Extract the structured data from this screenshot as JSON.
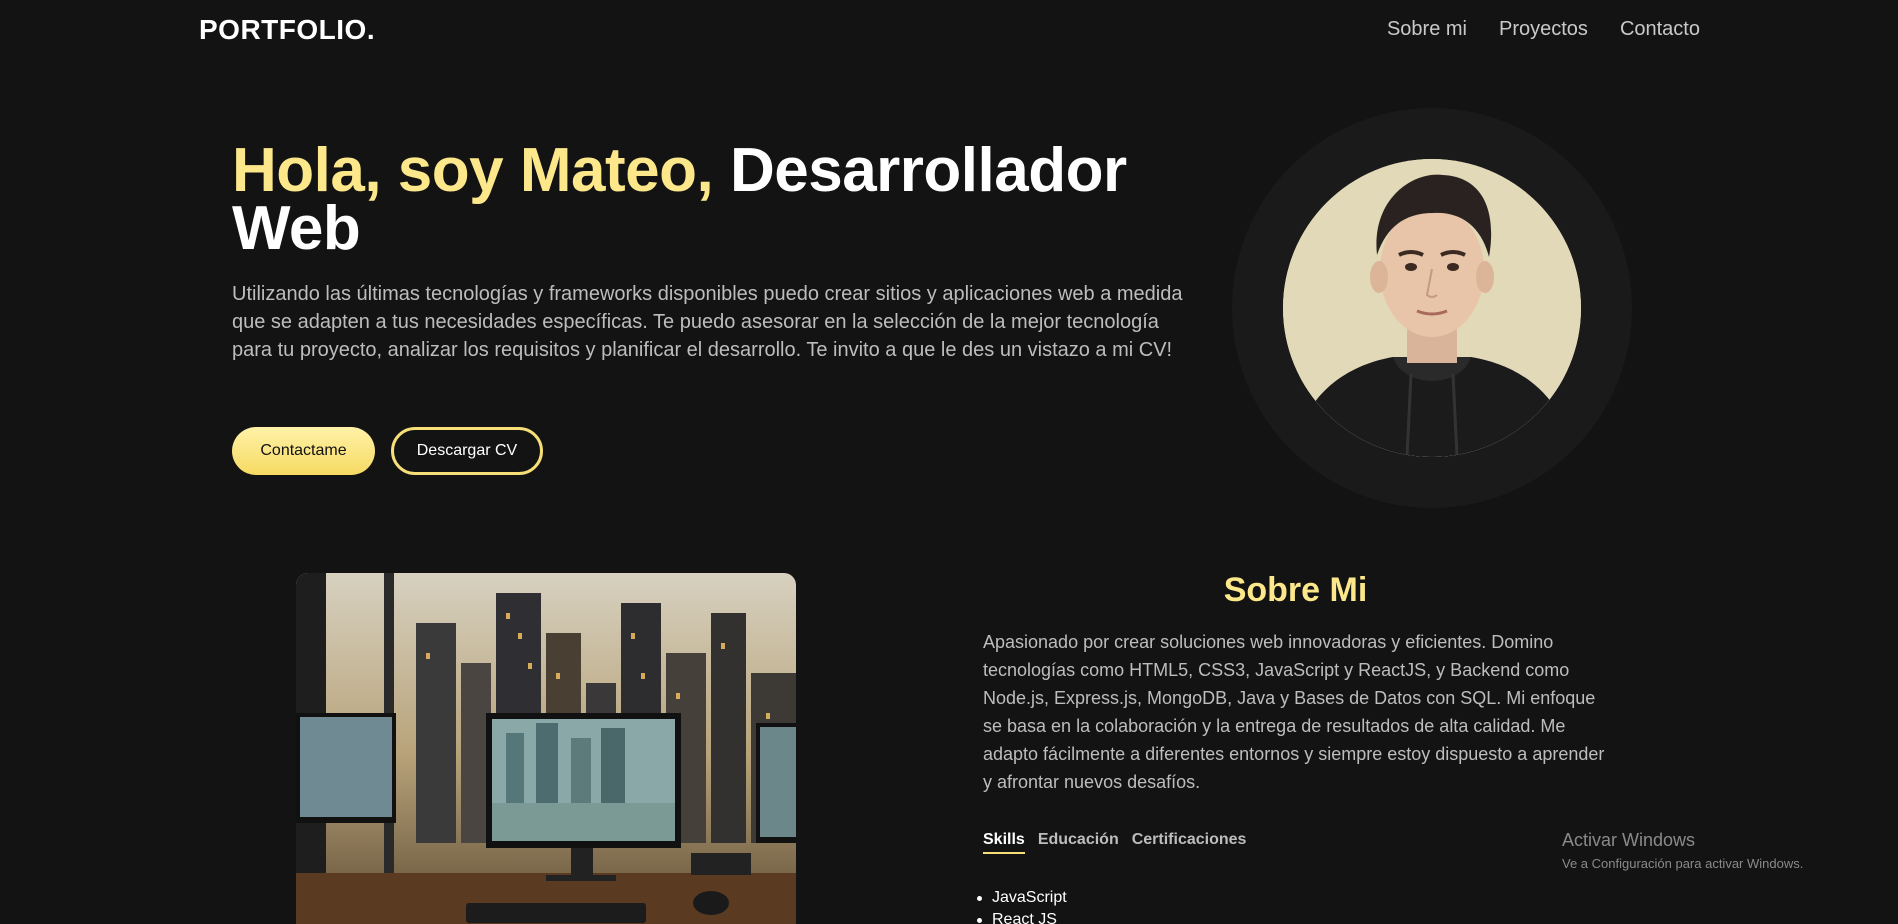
{
  "header": {
    "logo": "PORTFOLIO.",
    "nav": [
      {
        "label": "Sobre mi"
      },
      {
        "label": "Proyectos"
      },
      {
        "label": "Contacto"
      }
    ]
  },
  "hero": {
    "title_highlight": "Hola, soy Mateo,",
    "title_rest": "Desarrollador Web",
    "description": "Utilizando las últimas tecnologías y frameworks disponibles puedo crear sitios y aplicaciones web a medida que se adapten a tus necesidades específicas. Te puedo asesorar en la selección de la mejor tecnología para tu proyecto, analizar los requisitos y planificar el desarrollo. Te invito a que le des un vistazo a mi CV!",
    "primary_button": "Contactame",
    "secondary_button": "Descargar CV"
  },
  "about": {
    "title": "Sobre Mi",
    "text": "Apasionado por crear soluciones web innovadoras y eficientes. Domino tecnologías como HTML5, CSS3, JavaScript y ReactJS, y Backend como Node.js, Express.js, MongoDB, Java y Bases de Datos con SQL. Mi enfoque se basa en la colaboración y la entrega de resultados de alta calidad. Me adapto fácilmente a diferentes entornos y siempre estoy dispuesto a aprender y afrontar nuevos desafíos.",
    "tabs": [
      {
        "label": "Skills"
      },
      {
        "label": "Educación"
      },
      {
        "label": "Certificaciones"
      }
    ],
    "skills": [
      "JavaScript",
      "React JS"
    ]
  },
  "watermark": {
    "title": "Activar Windows",
    "subtitle": "Ve a Configuración para activar Windows."
  },
  "colors": {
    "background": "#131313",
    "accent": "#fce88a",
    "text_muted": "#bdbdbd"
  }
}
